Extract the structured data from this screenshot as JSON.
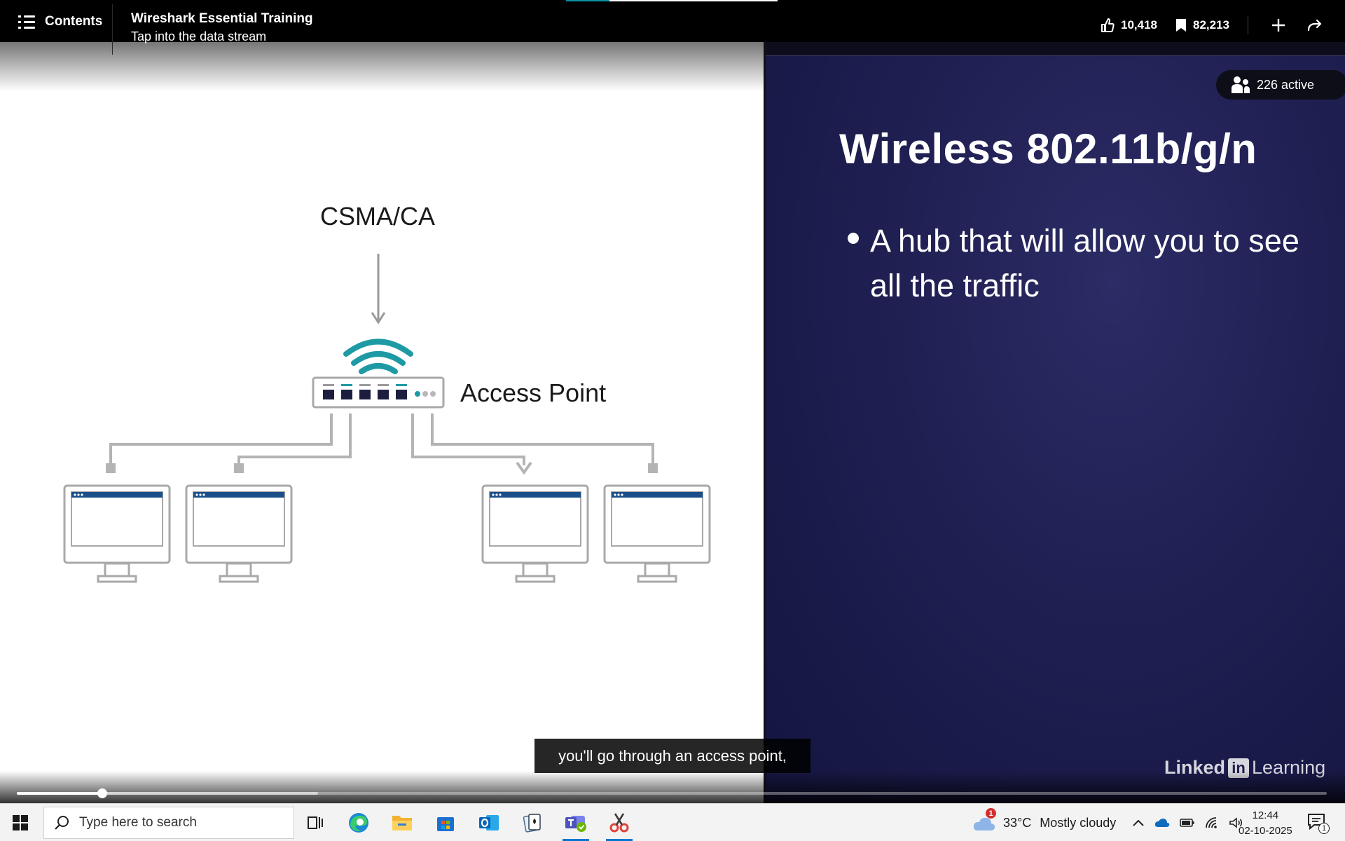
{
  "topbar": {
    "contents_label": "Contents",
    "course_title": "Wireshark Essential Training",
    "course_subtitle": "Tap into the data stream",
    "likes": "10,418",
    "saves": "82,213"
  },
  "video": {
    "active_count": "226 active",
    "caption": "you'll go through an access point,",
    "progress_fraction": 0.065,
    "buffer_fraction": 0.23,
    "diagram": {
      "protocol_label": "CSMA/CA",
      "device_label": "Access Point"
    },
    "slide": {
      "title": "Wireless 802.11b/g/n",
      "bullets": [
        "A hub that will allow you to see all the traffic"
      ]
    },
    "brand": {
      "linked": "Linked",
      "in": "in",
      "learning": "Learning"
    }
  },
  "taskbar": {
    "search_placeholder": "Type here to search",
    "weather_temp": "33°C",
    "weather_desc": "Mostly cloudy",
    "weather_badge": "1",
    "time": "12:44",
    "date": "02-10-2025",
    "notification_count": "1",
    "apps": [
      "task-view",
      "edge",
      "file-explorer",
      "microsoft-store",
      "outlook",
      "solitaire",
      "teams",
      "snipping-tool"
    ]
  },
  "colors": {
    "accent_teal": "#0a8fa3",
    "slide_bg": "#1f1f52",
    "windows_blue": "#0078d4"
  }
}
